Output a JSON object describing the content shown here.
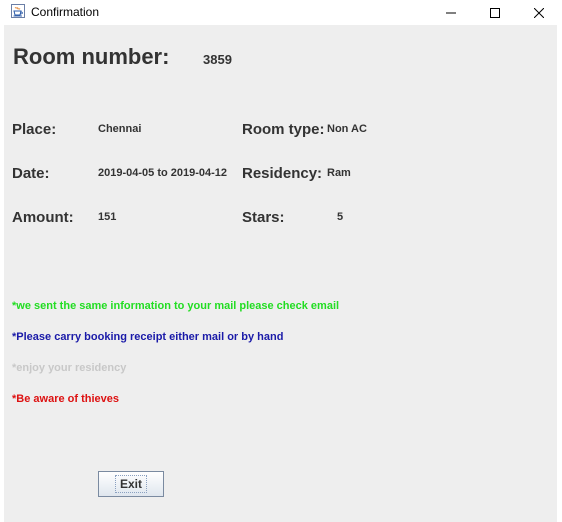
{
  "window": {
    "title": "Confirmation",
    "app_icon": "java-coffee-icon",
    "controls": [
      "minimize-icon",
      "maximize-icon",
      "close-icon"
    ]
  },
  "booking": {
    "room_number_label": "Room number:",
    "room_number_value": "3859",
    "place_label": "Place:",
    "place_value": "Chennai",
    "room_type_label": "Room type:",
    "room_type_value": "Non AC",
    "date_label": "Date:",
    "date_value": "2019-04-05 to 2019-04-12",
    "residency_label": "Residency:",
    "residency_value": "Ram",
    "amount_label": "Amount:",
    "amount_value": "151",
    "stars_label": "Stars:",
    "stars_value": "5"
  },
  "messages": [
    {
      "text": "*we sent the same information to your mail please check email",
      "color": "#22dd22"
    },
    {
      "text": "*Please carry booking receipt either mail or by hand",
      "color": "#1a1aa8"
    },
    {
      "text": "*enjoy your residency",
      "color": "#c8c8c8"
    },
    {
      "text": "*Be aware of thieves",
      "color": "#dd1111"
    }
  ],
  "buttons": {
    "exit_label": "Exit"
  }
}
